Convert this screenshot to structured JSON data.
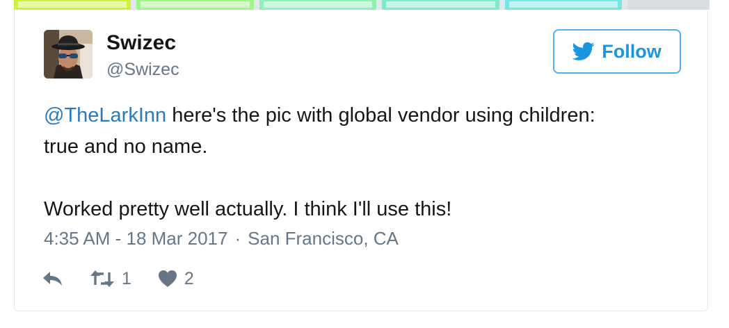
{
  "tweet": {
    "user": {
      "display_name": "Swizec",
      "screen_name": "@Swizec"
    },
    "follow_label": "Follow",
    "text": {
      "mention": "@TheLarkInn",
      "line1_rest": " here's the pic with global vendor using children:",
      "line2": "true and no name.",
      "line3": "Worked pretty well actually. I think I'll use this!"
    },
    "timestamp": "4:35 AM - 18 Mar 2017",
    "separator": "·",
    "location": "San Francisco, CA",
    "actions": {
      "retweet_count": "1",
      "like_count": "2"
    }
  },
  "icons": {
    "follow": "twitter-bird-icon",
    "reply": "reply-icon",
    "retweet": "retweet-icon",
    "like": "heart-icon"
  },
  "colors": {
    "link_blue": "#2b7bb9",
    "button_blue": "#1b95e0",
    "button_border": "#55acee",
    "muted_gray": "#657786",
    "text_dark": "#14171a",
    "card_border": "#e1e8ed"
  }
}
